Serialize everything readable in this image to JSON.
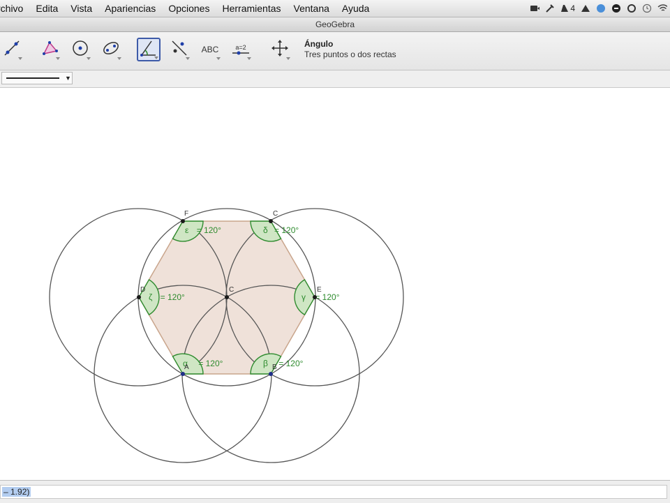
{
  "menubar": {
    "items": [
      "rchivo",
      "Edita",
      "Vista",
      "Apariencias",
      "Opciones",
      "Herramientas",
      "Ventana",
      "Ayuda"
    ],
    "status_text": "4"
  },
  "window": {
    "title": "GeoGebra"
  },
  "toolbar": {
    "selected_tool": {
      "name": "Ángulo",
      "description": "Tres puntos o dos rectas"
    },
    "tools": [
      {
        "icon": "line-icon"
      },
      {
        "icon": "polygon-icon"
      },
      {
        "icon": "circle-center-point-icon"
      },
      {
        "icon": "ellipse-icon"
      },
      {
        "icon": "angle-icon",
        "selected": true
      },
      {
        "icon": "reflect-line-icon"
      },
      {
        "icon": "text-icon",
        "label": "ABC"
      },
      {
        "icon": "slider-icon",
        "label": "a=2"
      },
      {
        "icon": "move-view-icon"
      }
    ]
  },
  "graphics": {
    "points": [
      {
        "name": "F"
      },
      {
        "name": "C"
      },
      {
        "name": "D"
      },
      {
        "name": "C"
      },
      {
        "name": "E"
      },
      {
        "name": "A"
      },
      {
        "name": "B"
      }
    ],
    "angle_labels": [
      {
        "symbol": "ε",
        "value": "= 120°"
      },
      {
        "symbol": "δ",
        "value": "= 120°"
      },
      {
        "symbol": "ζ",
        "value": "= 120°"
      },
      {
        "symbol": "γ",
        "value": "= 120°"
      },
      {
        "symbol": "α",
        "value": "= 120°"
      },
      {
        "symbol": "β",
        "value": "= 120°"
      }
    ]
  },
  "input_bar": {
    "value": "– 1.92)"
  },
  "colors": {
    "hexagon_fill": "#efe1d9",
    "hexagon_stroke": "#c9a58c",
    "angle_green": "#2e8b2e",
    "angle_fill": "#cfe6c4",
    "point": "#1a1a1a",
    "selection_blue": "#3d5aa8"
  }
}
